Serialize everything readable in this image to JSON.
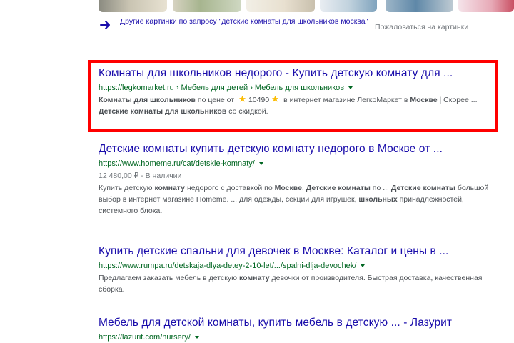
{
  "images": {
    "more_text": "Другие картинки по запросу \"детские комнаты для школьников москва\"",
    "complain_text": "Пожаловаться на картинки"
  },
  "results": [
    {
      "title": "Комнаты для школьников недорого - Купить детскую комнату для ...",
      "url": "https://legkomarket.ru › Мебель для детей › Мебель для школьников",
      "desc": {
        "b1": "Комнаты для школьников",
        "t1": " по цене от ",
        "rating": "10490",
        "t2": " в интернет магазине ЛегкоМаркет в ",
        "b2": "Москве",
        "t3": " | Скорее ... ",
        "b3": "Детские комнаты для школьников",
        "t4": " со скидкой."
      },
      "highlighted": true
    },
    {
      "title": "Детские комнаты купить детскую комнату недорого в Москве от ...",
      "url": "https://www.homeme.ru/cat/detskie-komnaty/",
      "meta": "12 480,00 ₽ - В наличии",
      "desc": {
        "t1": "Купить детскую ",
        "b1": "комнату",
        "t2": " недорого с доставкой по ",
        "b2": "Москве",
        "t3": ". ",
        "b3": "Детские комнаты",
        "t4": " по ... ",
        "b4": "Детские комнаты",
        "t5": " большой выбор в интернет магазине Homeme. ... для одежды, секции для игрушек, ",
        "b5": "школьных",
        "t6": " принадлежностей, системного блока."
      }
    },
    {
      "title": "Купить детские спальни для девочек в Москве: Каталог и цены в ...",
      "url": "https://www.rumpa.ru/detskaja-dlya-detey-2-10-let/.../spalni-dlja-devochek/",
      "desc": {
        "t1": "Предлагаем заказать мебель в детскую ",
        "b1": "комнату",
        "t2": " девочки от производителя. Быстрая доставка, качественная сборка."
      }
    },
    {
      "title": "Мебель для детской комнаты, купить мебель в детскую ... - Лазурит",
      "url": "https://lazurit.com/nursery/"
    }
  ],
  "colors": {
    "link": "#1a0dab",
    "url": "#006621",
    "highlight_box": "#ff0000",
    "star": "#fbbc04"
  }
}
